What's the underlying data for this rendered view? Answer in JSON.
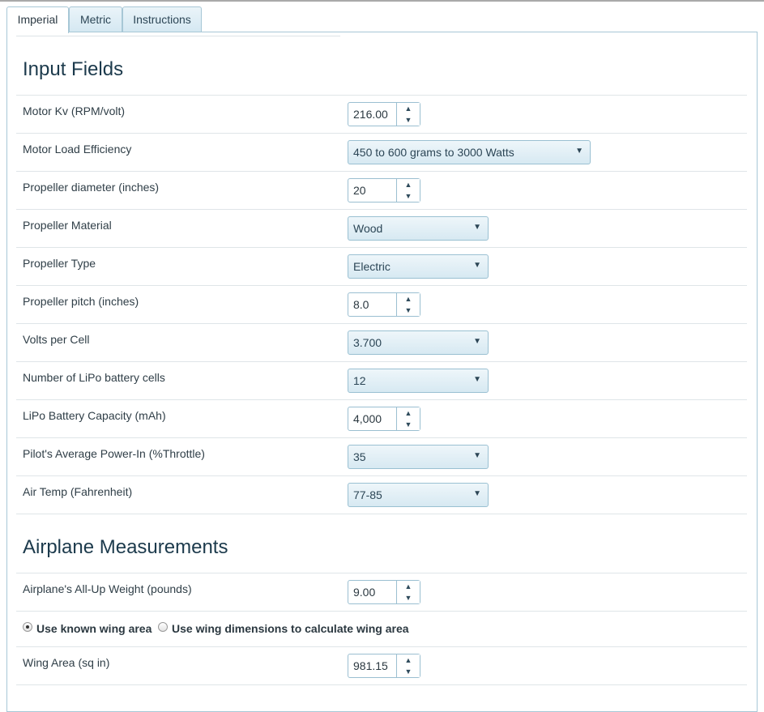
{
  "tabs": [
    {
      "label": "Imperial",
      "active": true
    },
    {
      "label": "Metric",
      "active": false
    },
    {
      "label": "Instructions",
      "active": false
    }
  ],
  "sections": {
    "input_title": "Input Fields",
    "airplane_title": "Airplane Measurements"
  },
  "fields": {
    "motor_kv": {
      "label": "Motor Kv (RPM/volt)",
      "value": "216.00"
    },
    "motor_load": {
      "label": "Motor Load Efficiency",
      "value": "450 to 600 grams to 3000 Watts"
    },
    "prop_diameter": {
      "label": "Propeller diameter (inches)",
      "value": "20"
    },
    "prop_material": {
      "label": "Propeller Material",
      "value": "Wood"
    },
    "prop_type": {
      "label": "Propeller Type",
      "value": "Electric"
    },
    "prop_pitch": {
      "label": "Propeller pitch (inches)",
      "value": "8.0"
    },
    "volts_cell": {
      "label": "Volts per Cell",
      "value": "3.700"
    },
    "lipo_cells": {
      "label": "Number of LiPo battery cells",
      "value": "12"
    },
    "lipo_capacity": {
      "label": "LiPo Battery Capacity (mAh)",
      "value": "4,000"
    },
    "throttle": {
      "label": "Pilot's Average Power-In (%Throttle)",
      "value": "35"
    },
    "air_temp": {
      "label": "Air Temp (Fahrenheit)",
      "value": "77-85"
    },
    "weight": {
      "label": "Airplane's All-Up Weight (pounds)",
      "value": "9.00"
    },
    "wing_area": {
      "label": "Wing Area (sq in)",
      "value": "981.15"
    }
  },
  "wing_mode": {
    "known_label": "Use known wing area",
    "calc_label": "Use wing dimensions to calculate wing area",
    "selected": "known"
  },
  "icons": {
    "spin_up": "▲",
    "spin_down": "▼",
    "dropdown": "▼"
  },
  "colors": {
    "tab_border": "#a7c7d6",
    "heading": "#1c3a4c",
    "select_bg": "#d7e9f2"
  }
}
